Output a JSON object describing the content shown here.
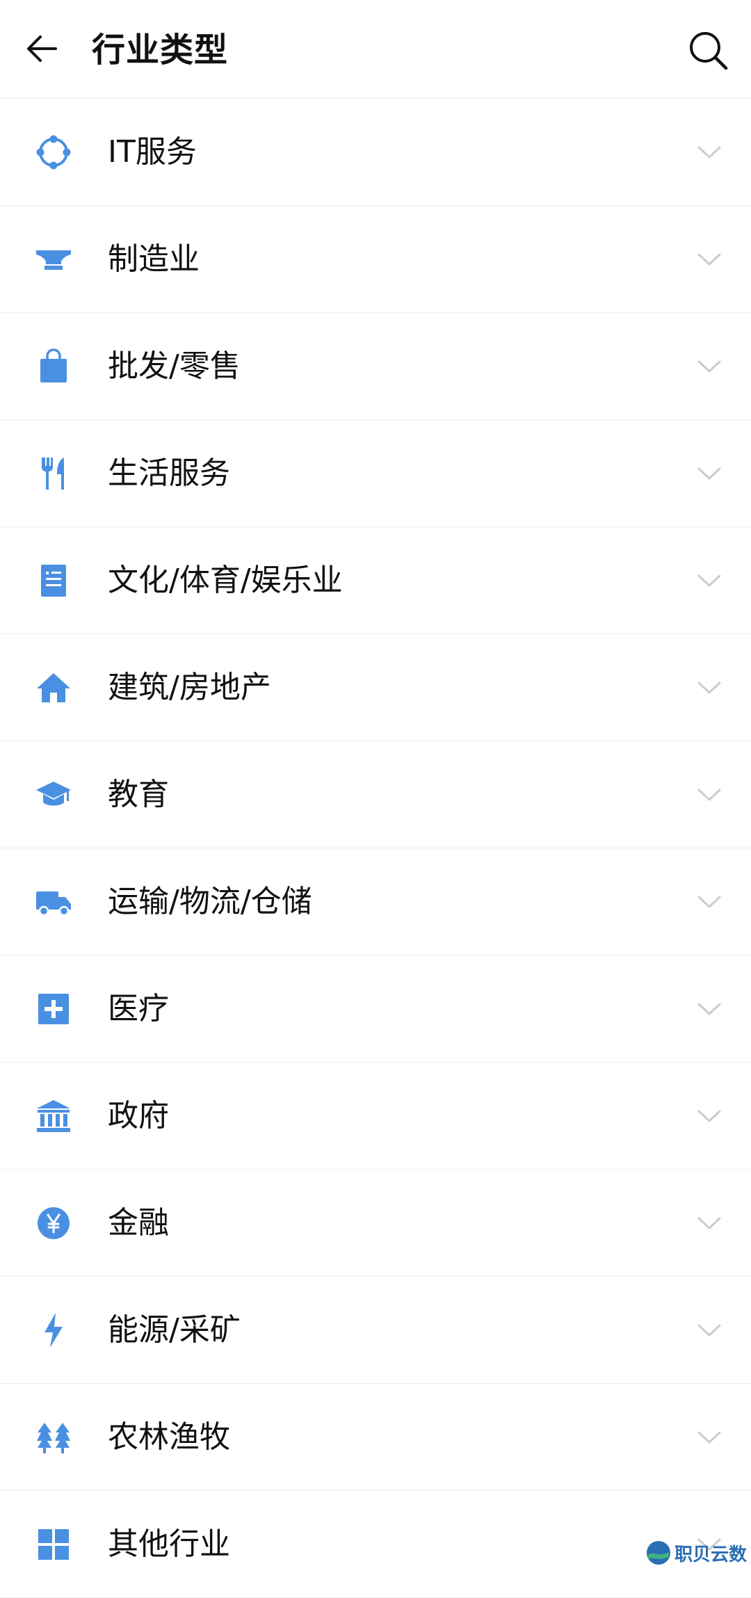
{
  "header": {
    "title": "行业类型"
  },
  "theme": {
    "accent": "#4a90e2",
    "chevron": "#cccccc"
  },
  "industries": [
    {
      "label": "IT服务",
      "icon": "network-icon"
    },
    {
      "label": "制造业",
      "icon": "anvil-icon"
    },
    {
      "label": "批发/零售",
      "icon": "shopping-bag-icon"
    },
    {
      "label": "生活服务",
      "icon": "fork-knife-icon"
    },
    {
      "label": "文化/体育/娱乐业",
      "icon": "document-icon"
    },
    {
      "label": "建筑/房地产",
      "icon": "house-icon"
    },
    {
      "label": "教育",
      "icon": "graduation-cap-icon"
    },
    {
      "label": "运输/物流/仓储",
      "icon": "truck-icon"
    },
    {
      "label": "医疗",
      "icon": "medical-plus-icon"
    },
    {
      "label": "政府",
      "icon": "government-building-icon"
    },
    {
      "label": "金融",
      "icon": "yen-coin-icon"
    },
    {
      "label": "能源/采矿",
      "icon": "lightning-icon"
    },
    {
      "label": "农林渔牧",
      "icon": "trees-icon"
    },
    {
      "label": "其他行业",
      "icon": "grid-icon"
    }
  ],
  "watermark": {
    "text": "职贝云数"
  }
}
